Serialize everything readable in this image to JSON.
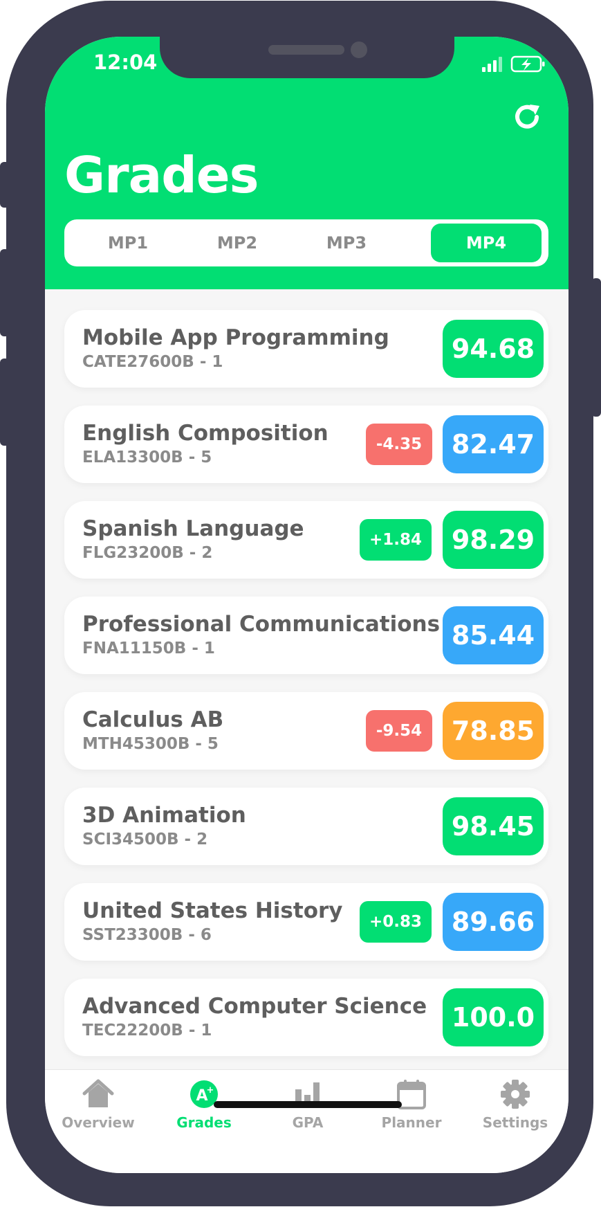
{
  "colors": {
    "accent": "#02de73",
    "grade_green": "#02de73",
    "grade_blue": "#37a8f9",
    "grade_orange": "#fea830",
    "delta_negative": "#f7716d",
    "delta_positive": "#02de73",
    "frame": "#3b3b4e"
  },
  "status_bar": {
    "time": "12:04",
    "icons": [
      "signal-icon",
      "battery-charging-icon"
    ]
  },
  "header": {
    "title": "Grades",
    "refresh_icon": "refresh-icon"
  },
  "tabs": [
    {
      "label": "MP1",
      "active": false
    },
    {
      "label": "MP2",
      "active": false
    },
    {
      "label": "MP3",
      "active": false
    },
    {
      "label": "MP4",
      "active": true
    }
  ],
  "courses": [
    {
      "name": "Mobile App Programming",
      "code": "CATE27600B - 1",
      "grade": "94.68",
      "grade_color": "green",
      "delta": null
    },
    {
      "name": "English Composition",
      "code": "ELA13300B - 5",
      "grade": "82.47",
      "grade_color": "blue",
      "delta": "-4.35",
      "delta_type": "negative"
    },
    {
      "name": "Spanish Language",
      "code": "FLG23200B - 2",
      "grade": "98.29",
      "grade_color": "green",
      "delta": "+1.84",
      "delta_type": "positive"
    },
    {
      "name": "Professional Communications",
      "code": "FNA11150B - 1",
      "grade": "85.44",
      "grade_color": "blue",
      "delta": null
    },
    {
      "name": "Calculus AB",
      "code": "MTH45300B - 5",
      "grade": "78.85",
      "grade_color": "orange",
      "delta": "-9.54",
      "delta_type": "negative"
    },
    {
      "name": "3D Animation",
      "code": "SCI34500B - 2",
      "grade": "98.45",
      "grade_color": "green",
      "delta": null
    },
    {
      "name": "United States History",
      "code": "SST23300B - 6",
      "grade": "89.66",
      "grade_color": "blue",
      "delta": "+0.83",
      "delta_type": "positive"
    },
    {
      "name": "Advanced Computer Science",
      "code": "TEC22200B - 1",
      "grade": "100.0",
      "grade_color": "green",
      "delta": null
    }
  ],
  "tab_bar": [
    {
      "label": "Overview",
      "icon": "home-icon",
      "active": false
    },
    {
      "label": "Grades",
      "icon": "grade-badge-icon",
      "active": true
    },
    {
      "label": "GPA",
      "icon": "bar-chart-icon",
      "active": false
    },
    {
      "label": "Planner",
      "icon": "calendar-icon",
      "active": false
    },
    {
      "label": "Settings",
      "icon": "gear-icon",
      "active": false
    }
  ]
}
